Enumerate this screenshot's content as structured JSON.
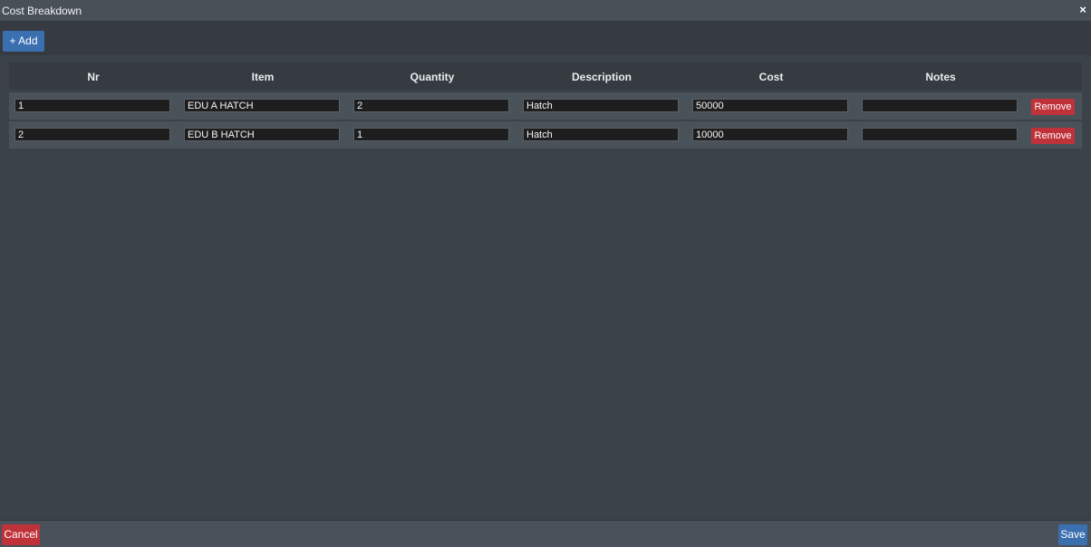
{
  "window": {
    "title": "Cost Breakdown",
    "close_glyph": "×"
  },
  "toolbar": {
    "add_label": "+ Add"
  },
  "table": {
    "columns": [
      "Nr",
      "Item",
      "Quantity",
      "Description",
      "Cost",
      "Notes"
    ],
    "rows": [
      {
        "nr": "1",
        "item": "EDU A HATCH",
        "quantity": "2",
        "description": "Hatch",
        "cost": "50000",
        "notes": "",
        "remove_label": "Remove"
      },
      {
        "nr": "2",
        "item": "EDU B HATCH",
        "quantity": "1",
        "description": "Hatch",
        "cost": "10000",
        "notes": "",
        "remove_label": "Remove"
      }
    ]
  },
  "footer": {
    "cancel_label": "Cancel",
    "save_label": "Save"
  },
  "colors": {
    "primary": "#3a6fb0",
    "danger": "#c0323a",
    "background": "#3b4249"
  }
}
